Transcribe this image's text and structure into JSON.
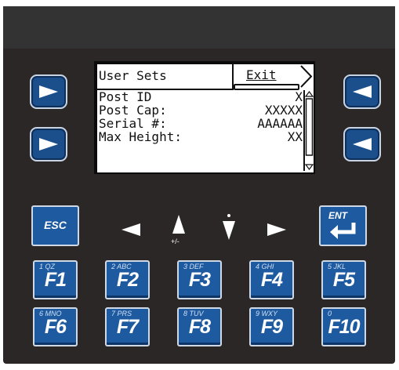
{
  "lcd": {
    "title": "User Sets",
    "exit_label": "Exit",
    "rows": [
      {
        "label": "Post ID",
        "value": "X"
      },
      {
        "label": "Post Cap:",
        "value": "XXXXX"
      },
      {
        "label": "Serial #:",
        "value": "AAAAAA"
      },
      {
        "label": "Max Height:",
        "value": "XX"
      }
    ]
  },
  "keys": {
    "esc_label": "ESC",
    "ent_label": "ENT",
    "plus_minus_label": "+/-",
    "function_keys": [
      {
        "main": "F1",
        "sub": "1   QZ"
      },
      {
        "main": "F2",
        "sub": "2   ABC"
      },
      {
        "main": "F3",
        "sub": "3   DEF"
      },
      {
        "main": "F4",
        "sub": "4   GHI"
      },
      {
        "main": "F5",
        "sub": "5   JKL"
      },
      {
        "main": "F6",
        "sub": "6   MNO"
      },
      {
        "main": "F7",
        "sub": "7   PRS"
      },
      {
        "main": "F8",
        "sub": "8   TUV"
      },
      {
        "main": "F9",
        "sub": "9   WXY"
      },
      {
        "main": "F10",
        "sub": "0"
      }
    ]
  },
  "colors": {
    "panel": "#2b2726",
    "key_blue": "#1e5aa0",
    "lcd_background": "#ffffff"
  }
}
